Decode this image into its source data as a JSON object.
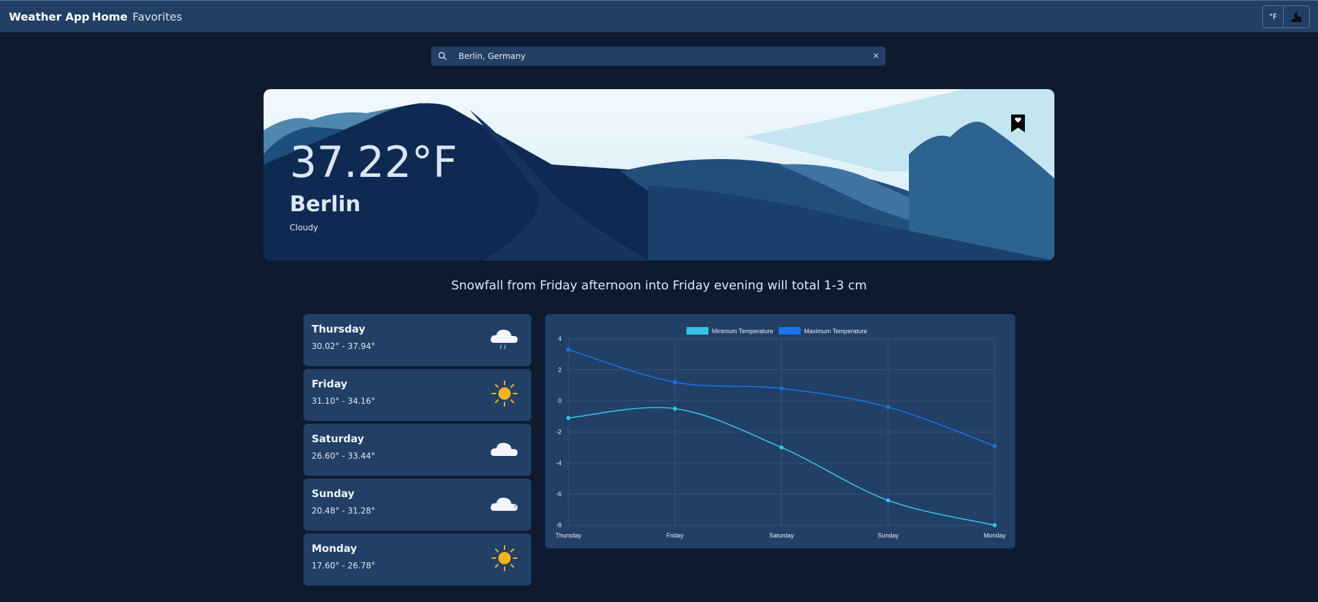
{
  "nav": {
    "brand": "Weather App",
    "home": "Home",
    "favorites": "Favorites",
    "unit_toggle": "°F"
  },
  "search": {
    "value": "Berlin, Germany",
    "clear": "×"
  },
  "current": {
    "temperature": "37.22°F",
    "city": "Berlin",
    "condition": "Cloudy"
  },
  "summary": "Snowfall from Friday afternoon into Friday evening will total 1-3 cm",
  "forecast": [
    {
      "day": "Thursday",
      "range": "30.02° - 37.94°",
      "icon": "rain-cloud-icon"
    },
    {
      "day": "Friday",
      "range": "31.10° - 34.16°",
      "icon": "sun-icon"
    },
    {
      "day": "Saturday",
      "range": "26.60° - 33.44°",
      "icon": "cloud-icon"
    },
    {
      "day": "Sunday",
      "range": "20.48° - 31.28°",
      "icon": "snow-cloud-icon"
    },
    {
      "day": "Monday",
      "range": "17.60° - 26.78°",
      "icon": "sun-icon"
    }
  ],
  "colors": {
    "min_series": "#36c2e8",
    "max_series": "#1a74e8",
    "card": "#223f66",
    "background": "#0e1b2e"
  },
  "chart_data": {
    "type": "line",
    "categories": [
      "Thursday",
      "Friday",
      "Saturday",
      "Sunday",
      "Monday"
    ],
    "series": [
      {
        "name": "Minimum Temperature",
        "values": [
          -1.1,
          -0.5,
          -3.0,
          -6.4,
          -8.0
        ]
      },
      {
        "name": "Maximum Temperature",
        "values": [
          3.3,
          1.2,
          0.8,
          -0.4,
          -2.9
        ]
      }
    ],
    "yticks": [
      "4",
      "2",
      "0",
      "-2",
      "-4",
      "-6",
      "-8"
    ],
    "ylim": [
      -8,
      4
    ],
    "grid": true,
    "legend": "top-center"
  }
}
